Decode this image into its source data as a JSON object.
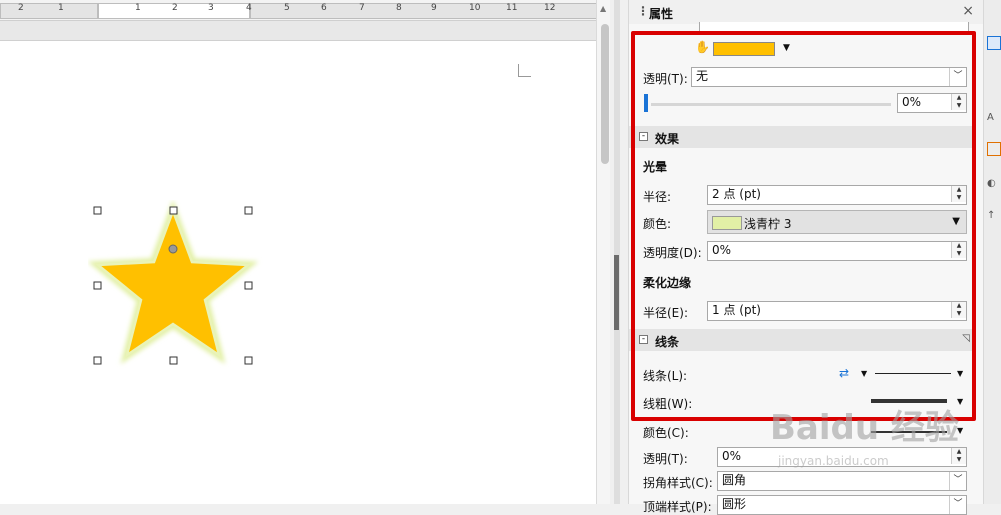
{
  "panel": {
    "title": "属性",
    "close": "×",
    "truncated_top_value": "...",
    "fill_color": "#FFC000",
    "transparency": {
      "label": "透明(T):",
      "value": "无"
    },
    "slider": {
      "value": "0%",
      "level": 0
    },
    "effects": {
      "title": "效果",
      "glow": {
        "title": "光晕",
        "radius_label": "半径:",
        "radius_value": "2 点 (pt)",
        "color_label": "颜色:",
        "color_name": "浅青柠 3",
        "color_hex": "#E2F0A6",
        "transparency_label": "透明度(D):",
        "transparency_value": "0%"
      },
      "soft_edge": {
        "title": "柔化边缘",
        "radius_label": "半径(E):",
        "radius_value": "1 点 (pt)"
      }
    },
    "lines": {
      "title": "线条",
      "line_label": "线条(L):",
      "width_label": "线粗(W):",
      "color_label": "颜色(C):",
      "transparency_label": "透明(T):",
      "transparency_value": "0%",
      "corner_label": "拐角样式(C):",
      "corner_value": "圆角",
      "cap_label": "顶端样式(P):",
      "cap_value": "圆形"
    }
  },
  "ruler": {
    "labels": [
      "2",
      "1",
      "1",
      "2",
      "3",
      "4",
      "5",
      "6",
      "7",
      "8",
      "9",
      "10",
      "11",
      "12"
    ]
  },
  "shape": {
    "fill": "#FFC000",
    "glow": "#E2F0A6"
  },
  "watermark": {
    "main": "Baidu 经验",
    "sub": "jingyan.baidu.com"
  }
}
